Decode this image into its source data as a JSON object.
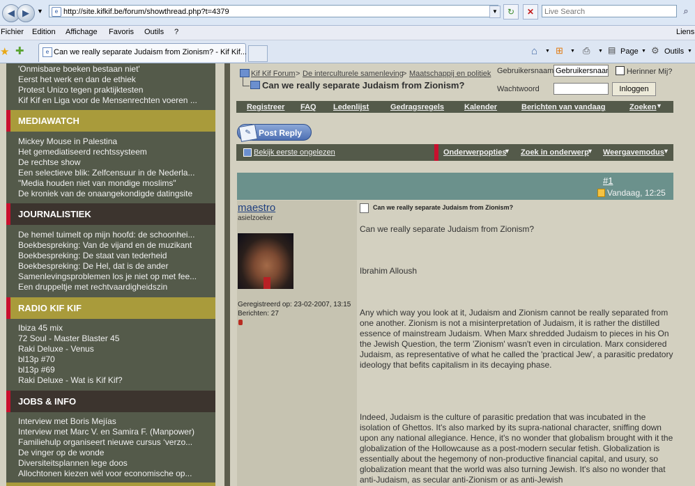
{
  "browser": {
    "url": "http://site.kifkif.be/forum/showthread.php?t=4379",
    "search_placeholder": "Live Search",
    "menu": [
      "Fichier",
      "Edition",
      "Affichage",
      "Favoris",
      "Outils",
      "?"
    ],
    "menu_right": "Liens",
    "tab_title": "Can we really separate Judaism from Zionism? - Kif Kif...",
    "tools": {
      "page": "Page",
      "tools": "Outils"
    }
  },
  "sidebar": {
    "top_links": [
      "'Onmisbare boeken bestaan niet'",
      "Eerst het werk en dan de ethiek",
      "Protest Unizo tegen praktijktesten",
      "Kif Kif en Liga voor de Mensenrechten voeren ..."
    ],
    "sections": [
      {
        "title": "MEDIAWATCH",
        "links": [
          "Mickey Mouse in Palestina",
          "Het gemediatiseerd rechtssysteem",
          "De rechtse show",
          "Een selectieve blik: Zelfcensuur in de Nederla...",
          "\"Media houden niet van mondige moslims\"",
          "De kroniek van de onaangekondigde datingsite"
        ]
      },
      {
        "title": "JOURNALISTIEK",
        "links": [
          "De hemel tuimelt op mijn hoofd: de schoonhei...",
          "Boekbespreking: Van de vijand en de muzikant",
          "Boekbespreking: De staat van tederheid",
          "Boekbespreking: De Hel, dat is de ander",
          "Samenlevingsproblemen los je niet op met fee...",
          "Een druppeltje met rechtvaardigheidszin"
        ]
      },
      {
        "title": "RADIO KIF KIF",
        "links": [
          "Ibiza 45 mix",
          "72 Soul - Master Blaster 45",
          "Raki Deluxe - Venus",
          "bl13p #70",
          "bl13p #69",
          "Raki Deluxe - Wat is Kif Kif?"
        ]
      },
      {
        "title": "JOBS & INFO",
        "links": [
          "Interview met Boris Mejías",
          "Interview met Marc V. en Samira F. (Manpower)",
          "Familiehulp organiseert nieuwe cursus ‘verzo...",
          "De vinger op de wonde",
          "Diversiteitsplannen lege doos",
          "Allochtonen kiezen wél voor economische op..."
        ]
      }
    ]
  },
  "breadcrumb": {
    "forum": "Kif Kif Forum",
    "sep": ">",
    "cat1": "De interculturele samenleving",
    "cat2": "Maatschappij en politiek"
  },
  "thread_title": "Can we really separate Judaism from Zionism?",
  "login": {
    "user_label": "Gebruikersnaam",
    "user_value": "Gebruikersnaam",
    "remember": "Herinner Mij?",
    "pass_label": "Wachtwoord",
    "button": "Inloggen"
  },
  "navbar": [
    "Registreer",
    "FAQ",
    "Ledenlijst",
    "Gedragsregels",
    "Kalender",
    "Berichten van vandaag",
    "Zoeken"
  ],
  "post_reply": "Post Reply",
  "toolsbar": {
    "first_unread": "Bekijk eerste ongelezen",
    "items": [
      "Onderwerpopties",
      "Zoek in onderwerp",
      "Weergavemodus"
    ]
  },
  "post": {
    "number": "#1",
    "date": "Vandaag, 12:25",
    "username": "maestro",
    "usertitle": "asielzoeker",
    "joined": "Geregistreerd op: 23-02-2007, 13:15",
    "posts": "Berichten: 27",
    "title": "Can we really separate Judaism from Zionism?",
    "body": [
      "Can we really separate Judaism from Zionism?",
      "Ibrahim Alloush",
      "Any which way you look at it, Judaism and Zionism cannot be really separated from one another. Zionism is not a misinterpretation of Judaism, it is rather the distilled essence of mainstream Judaism. When Marx shredded Judaism to pieces in his On the Jewish Question, the term 'Zionism' wasn't even in circulation. Marx considered Judaism, as representative of what he called the 'practical Jew', a parasitic predatory ideology that befits capitalism in its decaying phase.",
      "Indeed, Judaism is the culture of parasitic predation that was incubated in the isolation of Ghettos. It's also marked by its supra-national character, sniffing down upon any national allegiance. Hence, it's no wonder that globalism brought with it the globalization of the Hollowcause as a post-modern secular fetish. Globalization is essentially about the hegemony of non-productive financial capital, and usury, so globalization meant that the world was also turning Jewish. It's also no wonder that anti-Judaism, as secular anti-Zionism or as anti-Jewish"
    ]
  }
}
